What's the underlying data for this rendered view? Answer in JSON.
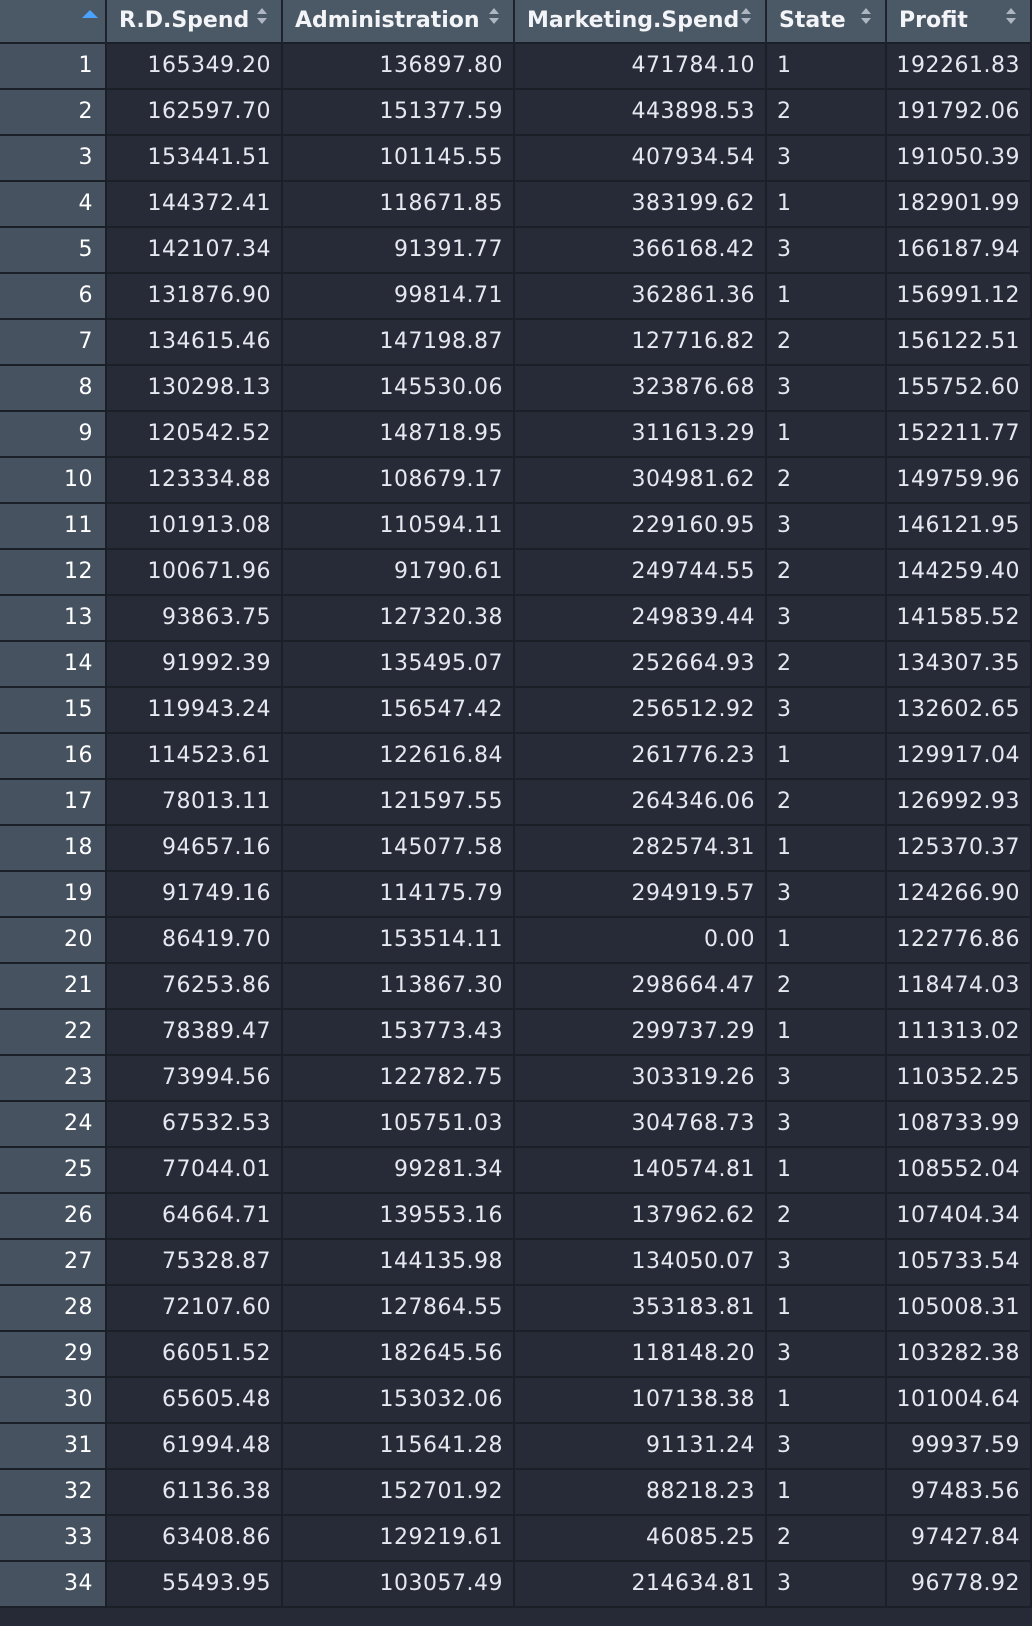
{
  "table": {
    "columns": [
      {
        "key": "RD",
        "label": "R.D.Spend"
      },
      {
        "key": "ADM",
        "label": "Administration"
      },
      {
        "key": "MKT",
        "label": "Marketing.Spend"
      },
      {
        "key": "ST",
        "label": "State"
      },
      {
        "key": "PR",
        "label": "Profit"
      }
    ],
    "sort_icons": {
      "index": "sort-ascending-icon",
      "columns": "sort-icon"
    },
    "accent_color": "#4aa3ff",
    "rows": [
      {
        "idx": "1",
        "rd": "165349.20",
        "adm": "136897.80",
        "mkt": "471784.10",
        "st": "1",
        "pr": "192261.83"
      },
      {
        "idx": "2",
        "rd": "162597.70",
        "adm": "151377.59",
        "mkt": "443898.53",
        "st": "2",
        "pr": "191792.06"
      },
      {
        "idx": "3",
        "rd": "153441.51",
        "adm": "101145.55",
        "mkt": "407934.54",
        "st": "3",
        "pr": "191050.39"
      },
      {
        "idx": "4",
        "rd": "144372.41",
        "adm": "118671.85",
        "mkt": "383199.62",
        "st": "1",
        "pr": "182901.99"
      },
      {
        "idx": "5",
        "rd": "142107.34",
        "adm": "91391.77",
        "mkt": "366168.42",
        "st": "3",
        "pr": "166187.94"
      },
      {
        "idx": "6",
        "rd": "131876.90",
        "adm": "99814.71",
        "mkt": "362861.36",
        "st": "1",
        "pr": "156991.12"
      },
      {
        "idx": "7",
        "rd": "134615.46",
        "adm": "147198.87",
        "mkt": "127716.82",
        "st": "2",
        "pr": "156122.51"
      },
      {
        "idx": "8",
        "rd": "130298.13",
        "adm": "145530.06",
        "mkt": "323876.68",
        "st": "3",
        "pr": "155752.60"
      },
      {
        "idx": "9",
        "rd": "120542.52",
        "adm": "148718.95",
        "mkt": "311613.29",
        "st": "1",
        "pr": "152211.77"
      },
      {
        "idx": "10",
        "rd": "123334.88",
        "adm": "108679.17",
        "mkt": "304981.62",
        "st": "2",
        "pr": "149759.96"
      },
      {
        "idx": "11",
        "rd": "101913.08",
        "adm": "110594.11",
        "mkt": "229160.95",
        "st": "3",
        "pr": "146121.95"
      },
      {
        "idx": "12",
        "rd": "100671.96",
        "adm": "91790.61",
        "mkt": "249744.55",
        "st": "2",
        "pr": "144259.40"
      },
      {
        "idx": "13",
        "rd": "93863.75",
        "adm": "127320.38",
        "mkt": "249839.44",
        "st": "3",
        "pr": "141585.52"
      },
      {
        "idx": "14",
        "rd": "91992.39",
        "adm": "135495.07",
        "mkt": "252664.93",
        "st": "2",
        "pr": "134307.35"
      },
      {
        "idx": "15",
        "rd": "119943.24",
        "adm": "156547.42",
        "mkt": "256512.92",
        "st": "3",
        "pr": "132602.65"
      },
      {
        "idx": "16",
        "rd": "114523.61",
        "adm": "122616.84",
        "mkt": "261776.23",
        "st": "1",
        "pr": "129917.04"
      },
      {
        "idx": "17",
        "rd": "78013.11",
        "adm": "121597.55",
        "mkt": "264346.06",
        "st": "2",
        "pr": "126992.93"
      },
      {
        "idx": "18",
        "rd": "94657.16",
        "adm": "145077.58",
        "mkt": "282574.31",
        "st": "1",
        "pr": "125370.37"
      },
      {
        "idx": "19",
        "rd": "91749.16",
        "adm": "114175.79",
        "mkt": "294919.57",
        "st": "3",
        "pr": "124266.90"
      },
      {
        "idx": "20",
        "rd": "86419.70",
        "adm": "153514.11",
        "mkt": "0.00",
        "st": "1",
        "pr": "122776.86"
      },
      {
        "idx": "21",
        "rd": "76253.86",
        "adm": "113867.30",
        "mkt": "298664.47",
        "st": "2",
        "pr": "118474.03"
      },
      {
        "idx": "22",
        "rd": "78389.47",
        "adm": "153773.43",
        "mkt": "299737.29",
        "st": "1",
        "pr": "111313.02"
      },
      {
        "idx": "23",
        "rd": "73994.56",
        "adm": "122782.75",
        "mkt": "303319.26",
        "st": "3",
        "pr": "110352.25"
      },
      {
        "idx": "24",
        "rd": "67532.53",
        "adm": "105751.03",
        "mkt": "304768.73",
        "st": "3",
        "pr": "108733.99"
      },
      {
        "idx": "25",
        "rd": "77044.01",
        "adm": "99281.34",
        "mkt": "140574.81",
        "st": "1",
        "pr": "108552.04"
      },
      {
        "idx": "26",
        "rd": "64664.71",
        "adm": "139553.16",
        "mkt": "137962.62",
        "st": "2",
        "pr": "107404.34"
      },
      {
        "idx": "27",
        "rd": "75328.87",
        "adm": "144135.98",
        "mkt": "134050.07",
        "st": "3",
        "pr": "105733.54"
      },
      {
        "idx": "28",
        "rd": "72107.60",
        "adm": "127864.55",
        "mkt": "353183.81",
        "st": "1",
        "pr": "105008.31"
      },
      {
        "idx": "29",
        "rd": "66051.52",
        "adm": "182645.56",
        "mkt": "118148.20",
        "st": "3",
        "pr": "103282.38"
      },
      {
        "idx": "30",
        "rd": "65605.48",
        "adm": "153032.06",
        "mkt": "107138.38",
        "st": "1",
        "pr": "101004.64"
      },
      {
        "idx": "31",
        "rd": "61994.48",
        "adm": "115641.28",
        "mkt": "91131.24",
        "st": "3",
        "pr": "99937.59"
      },
      {
        "idx": "32",
        "rd": "61136.38",
        "adm": "152701.92",
        "mkt": "88218.23",
        "st": "1",
        "pr": "97483.56"
      },
      {
        "idx": "33",
        "rd": "63408.86",
        "adm": "129219.61",
        "mkt": "46085.25",
        "st": "2",
        "pr": "97427.84"
      },
      {
        "idx": "34",
        "rd": "55493.95",
        "adm": "103057.49",
        "mkt": "214634.81",
        "st": "3",
        "pr": "96778.92"
      }
    ]
  }
}
